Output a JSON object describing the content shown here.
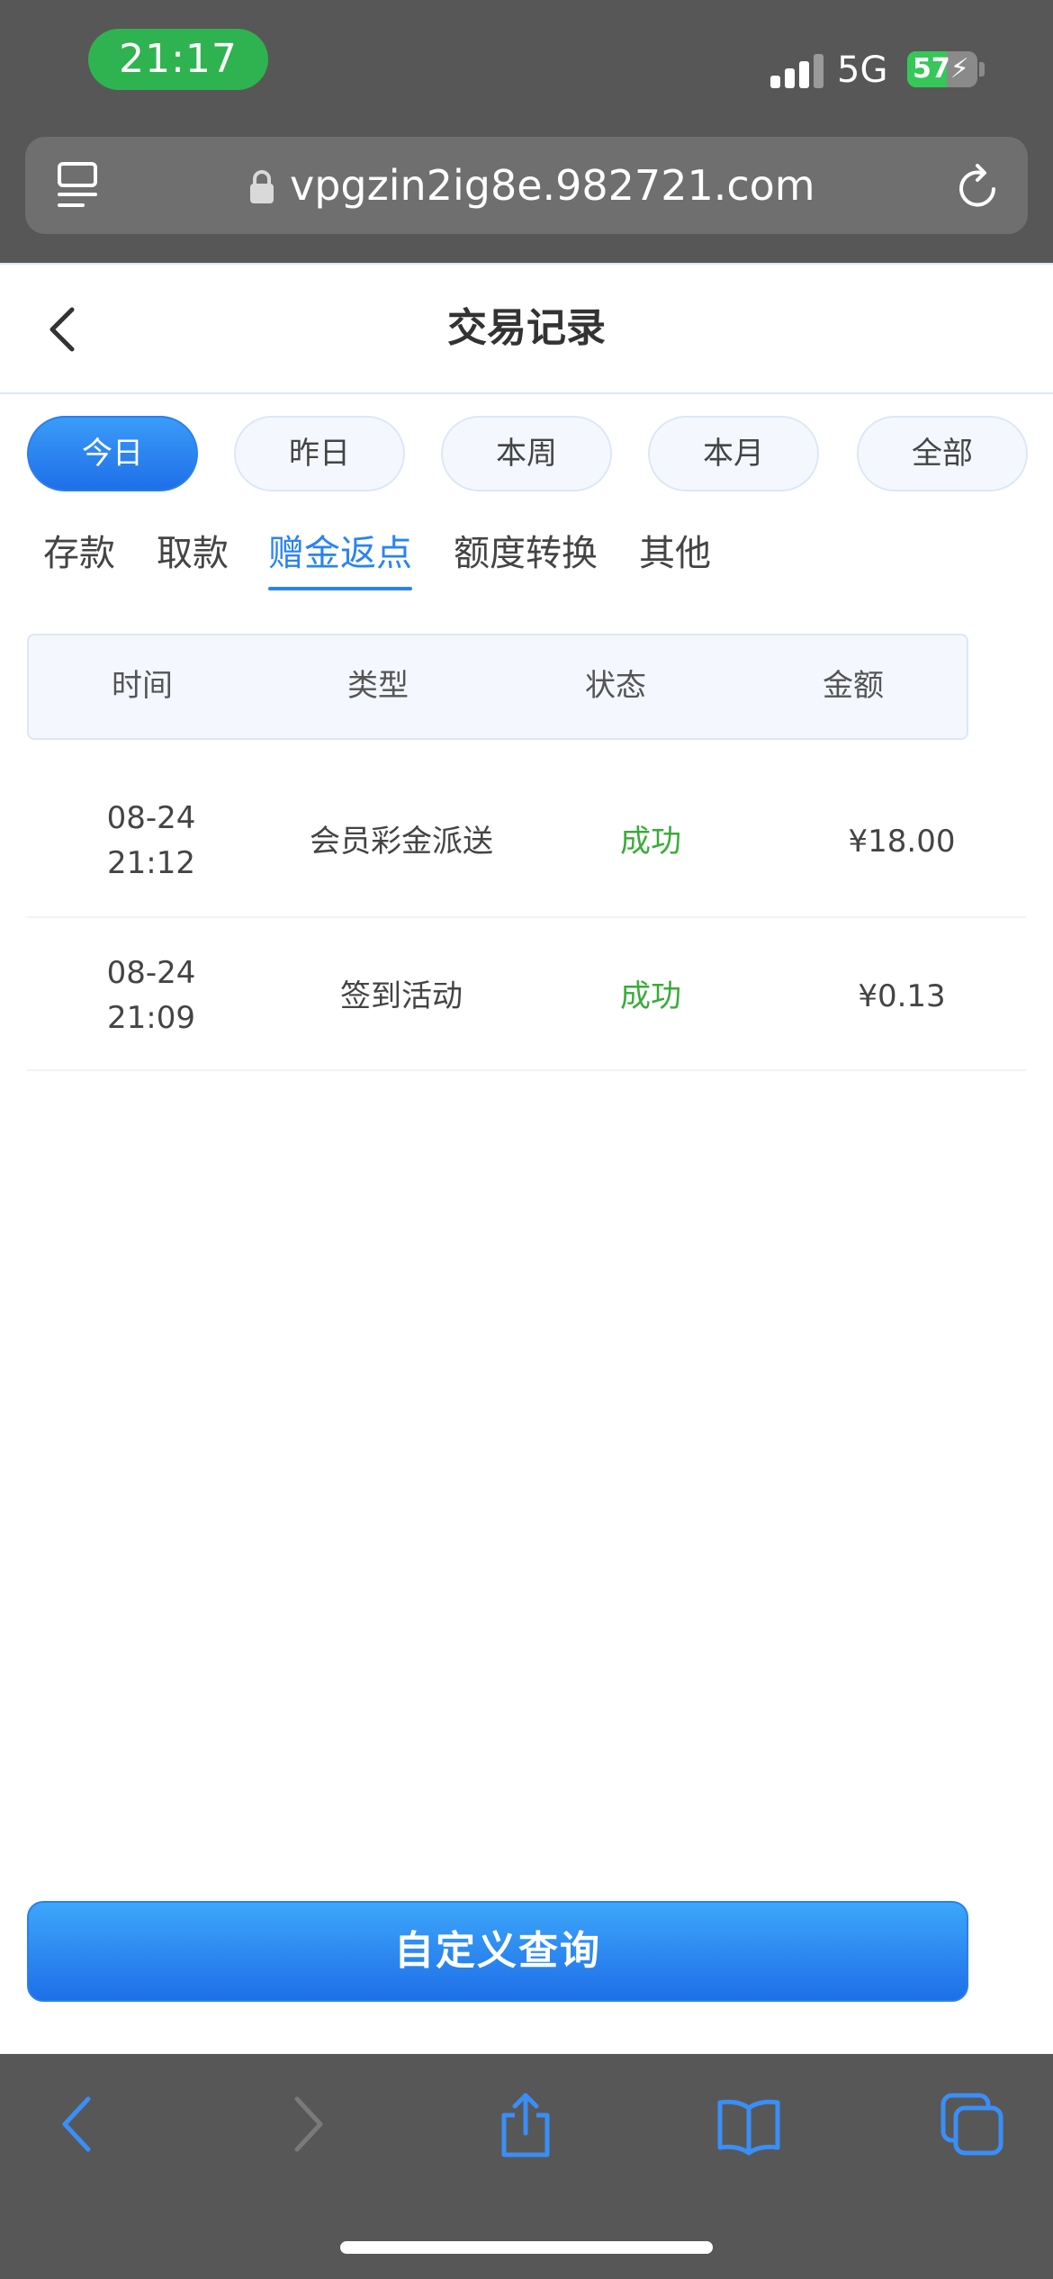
{
  "status_bar": {
    "time": "21:17",
    "network": "5G",
    "battery_level": "57",
    "battery_fraction": 0.57
  },
  "browser": {
    "url": "vpgzin2ig8e.982721.com",
    "icons": [
      "reader-icon",
      "lock-icon",
      "reload-icon"
    ]
  },
  "header": {
    "title": "交易记录",
    "back_icon": "chevron-left-icon"
  },
  "periods": [
    {
      "label": "今日",
      "active": true
    },
    {
      "label": "昨日",
      "active": false
    },
    {
      "label": "本周",
      "active": false
    },
    {
      "label": "本月",
      "active": false
    },
    {
      "label": "全部",
      "active": false
    }
  ],
  "categories": [
    {
      "label": "存款",
      "active": false
    },
    {
      "label": "取款",
      "active": false
    },
    {
      "label": "赠金返点",
      "active": true
    },
    {
      "label": "额度转换",
      "active": false
    },
    {
      "label": "其他",
      "active": false
    }
  ],
  "table": {
    "columns": [
      "时间",
      "类型",
      "状态",
      "金额"
    ],
    "rows": [
      {
        "date": "08-24",
        "time": "21:12",
        "type": "会员彩金派送",
        "status": "成功",
        "amount": "¥18.00"
      },
      {
        "date": "08-24",
        "time": "21:09",
        "type": "签到活动",
        "status": "成功",
        "amount": "¥0.13"
      }
    ]
  },
  "actions": {
    "custom_query": "自定义查询"
  },
  "toolbar": {
    "icons": [
      "back-arrow-icon",
      "forward-arrow-icon",
      "share-icon",
      "bookmarks-icon",
      "tabs-icon"
    ]
  },
  "colors": {
    "accent": "#2a84f0",
    "success": "#3aab3a",
    "chrome": "#575757"
  }
}
